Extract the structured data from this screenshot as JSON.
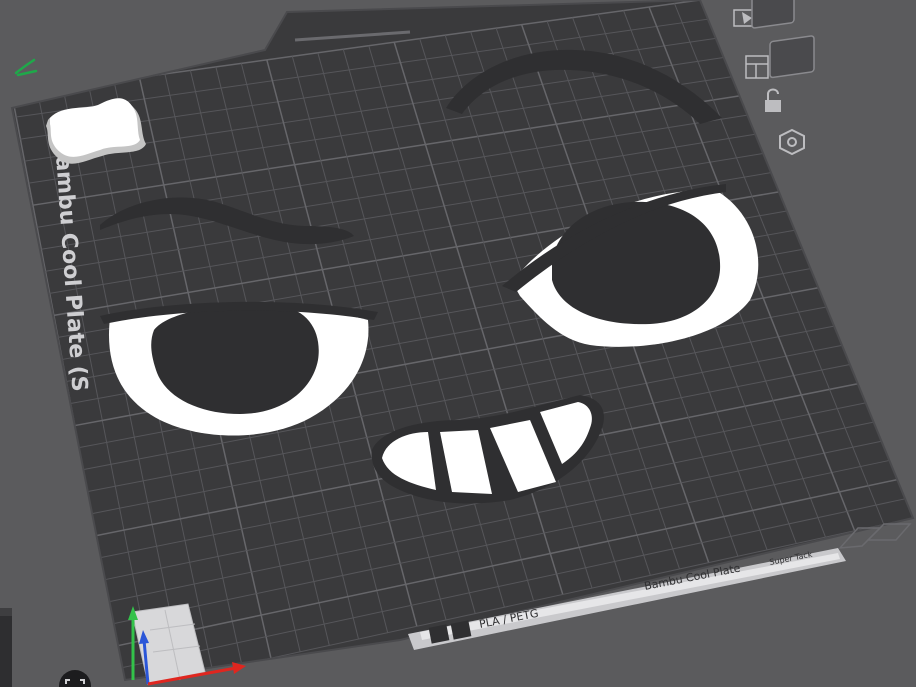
{
  "plate": {
    "side_label": "Bambu Cool Plate (S",
    "bottom_label": "Bambu Cool Plate",
    "bottom_sublabel": "Super Tack",
    "material_label": "PLA / PETG"
  },
  "toolbar": {
    "items": [
      {
        "name": "arrange-plate-icon"
      },
      {
        "name": "plate-layout-icon"
      },
      {
        "name": "lock-plate-icon"
      },
      {
        "name": "plate-settings-icon"
      }
    ]
  },
  "colors": {
    "background": "#5b5b5d",
    "plate": "#3a3a3c",
    "grid": "#5a5a5e",
    "model_dark": "#2f2f31",
    "model_white": "#ffffff",
    "axis_x": "#e0261f",
    "axis_y": "#33c24a",
    "axis_z": "#2a56d8"
  }
}
